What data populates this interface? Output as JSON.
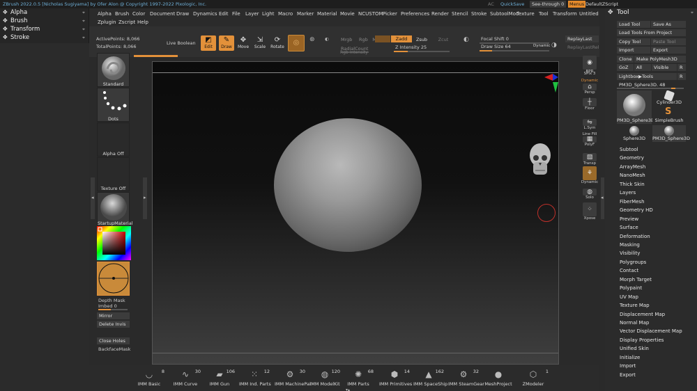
{
  "titlebar": {
    "title": "ZBrush 2022.0.5 [Nicholas Sugiyama] by Ofer Alon @ Copyright 1997-2022 Pixologic, Inc.",
    "ac": "AC",
    "quicksave": "QuickSave",
    "seethrough": "See-through  0",
    "menus": "Menus",
    "default_script": "DefaultZScript"
  },
  "left_palettes": [
    {
      "label": "Alpha",
      "icon": "alpha-icon"
    },
    {
      "label": "Brush",
      "icon": "brush-icon"
    },
    {
      "label": "Transform",
      "icon": "transform-icon"
    },
    {
      "label": "Stroke",
      "icon": "stroke-icon"
    }
  ],
  "menubar": {
    "row1": [
      "Alpha",
      "Brush",
      "Color",
      "Document",
      "Draw",
      "Dynamics",
      "Edit",
      "File",
      "Layer",
      "Light",
      "Macro",
      "Marker",
      "Material",
      "Movie",
      "NCUSTOM",
      "Picker",
      "Preferences",
      "Render",
      "Stencil",
      "Stroke",
      "SubtoolMod",
      "Texture",
      "Tool",
      "Transform",
      "Untitled"
    ],
    "row2": [
      "Zplugin",
      "Zscript",
      "Help"
    ]
  },
  "shelf": {
    "active_points": "ActivePoints: 8,066",
    "total_points": "TotalPoints: 8,066",
    "live_boolean": "Live Boolean",
    "edit": "Edit",
    "draw": "Draw",
    "move": "Move",
    "scale": "Scale",
    "rotate": "Rotate",
    "mrgb": "Mrgb",
    "rgb": "Rgb",
    "m": "M",
    "zadd": "Zadd",
    "zsub": "Zsub",
    "zcut": "Zcut",
    "radial_count": "RadialCount",
    "rgb_intensity": "Rgb Intensity",
    "z_intensity": "Z Intensity 25",
    "z_intensity_value": 25,
    "focal_shift": "Focal Shift 0",
    "draw_size": "Draw Size 64",
    "dynamic": "Dynamic",
    "replay_last": "ReplayLast",
    "replay_last_rel": "ReplayLastRel"
  },
  "left_tray": {
    "brush": "Standard",
    "stroke": "Dots",
    "alpha": "Alpha Off",
    "texture": "Texture Off",
    "material": "StartupMaterial",
    "depth_mask": "Depth Mask",
    "imbed": "Imbed 0",
    "mirror": "Mirror",
    "delete_invis": "Delete Invis",
    "close_holes": "Close Holes",
    "backface_mask": "BackfaceMask"
  },
  "right_tools": [
    {
      "label": "BPR",
      "icon": "bpr-icon"
    },
    {
      "label": "SPix 3",
      "icon": "spix-icon"
    },
    {
      "label": "Dynamic",
      "icon": "dynamic-icon"
    },
    {
      "label": "Persp",
      "icon": "persp-icon"
    },
    {
      "label": "Floor",
      "icon": "floor-icon"
    },
    {
      "label": "L.Sym",
      "icon": "lsym-icon"
    },
    {
      "label": "Line Fill",
      "icon": "linefill-icon"
    },
    {
      "label": "PolyF",
      "icon": "polyf-icon"
    },
    {
      "label": "Transp",
      "icon": "transp-icon"
    },
    {
      "label": "Dynamic",
      "icon": "dynamic-solo-icon"
    },
    {
      "label": "Solo",
      "icon": "solo-icon"
    },
    {
      "label": "Xpose",
      "icon": "xpose-icon"
    }
  ],
  "tool_panel": {
    "title": "Tool",
    "load_tool": "Load Tool",
    "save_as": "Save As",
    "load_from_project": "Load Tools From Project",
    "copy_tool": "Copy Tool",
    "paste_tool": "Paste Tool",
    "import": "Import",
    "export": "Export",
    "clone": "Clone",
    "make_polymesh": "Make PolyMesh3D",
    "goz": "GoZ",
    "all": "All",
    "visible": "Visible",
    "r": "R",
    "lightbox_tools": "Lightbox▶Tools",
    "current_tool": "PM3D_Sphere3D. 48",
    "thumbs": [
      {
        "label": "PM3D_Sphere3D",
        "icon": "sphere-icon"
      },
      {
        "label": "Cylinder3D",
        "icon": "cylinder-icon"
      },
      {
        "label": "SimpleBrush",
        "icon": "simplebrush-icon"
      },
      {
        "label": "Sphere3D",
        "icon": "sphere-small-icon"
      },
      {
        "label": "PM3D_Sphere3D",
        "icon": "sphere-small-icon"
      }
    ],
    "subpalettes": [
      "Subtool",
      "Geometry",
      "ArrayMesh",
      "NanoMesh",
      "Thick Skin",
      "Layers",
      "FiberMesh",
      "Geometry HD",
      "Preview",
      "Surface",
      "Deformation",
      "Masking",
      "Visibility",
      "Polygroups",
      "Contact",
      "Morph Target",
      "Polypaint",
      "UV Map",
      "Texture Map",
      "Displacement Map",
      "Normal Map",
      "Vector Displacement Map",
      "Display Properties",
      "Unified Skin",
      "Initialize",
      "Import",
      "Export"
    ]
  },
  "bottom_shelf": [
    {
      "label": "IMM Basic",
      "count": "8",
      "icon": "imm-basic-icon"
    },
    {
      "label": "IMM Curve",
      "count": "30",
      "icon": "imm-curve-icon"
    },
    {
      "label": "IMM Gun",
      "count": "106",
      "icon": "imm-gun-icon"
    },
    {
      "label": "IMM Ind. Parts",
      "count": "12",
      "icon": "imm-parts-icon"
    },
    {
      "label": "IMM MachinePai",
      "count": "30",
      "icon": "imm-machine-icon"
    },
    {
      "label": "IMM ModelKit",
      "count": "120",
      "icon": "imm-modelkit-icon"
    },
    {
      "label": "IMM Parts",
      "count": "68",
      "icon": "imm-parts2-icon"
    },
    {
      "label": "IMM Primitives",
      "count": "14",
      "icon": "imm-primitives-icon"
    },
    {
      "label": "IMM SpaceShip",
      "count": "162",
      "icon": "imm-spaceship-icon"
    },
    {
      "label": "IMM SteamGear",
      "count": "32",
      "icon": "imm-steamgear-icon"
    },
    {
      "label": "MeshProject",
      "count": "",
      "icon": "meshproject-icon"
    },
    {
      "label": "ZModeler",
      "count": "1",
      "icon": "zmodeler-icon"
    }
  ],
  "colors": {
    "accent": "#e3913a",
    "title_blue": "#6fb0d8",
    "cursor_red": "#c0302a"
  }
}
